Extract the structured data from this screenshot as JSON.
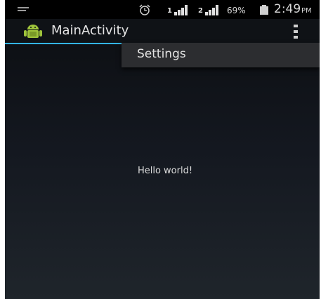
{
  "status_bar": {
    "battery_percent": "69%",
    "time": "2:49",
    "ampm": "PM",
    "sim1_label": "1",
    "sim2_label": "2",
    "icons": [
      "notification-icon",
      "alarm-icon",
      "signal-sim1-icon",
      "signal-sim2-icon",
      "battery-icon"
    ]
  },
  "action_bar": {
    "title": "MainActivity",
    "app_icon": "android-icon",
    "overflow_icon": "overflow-menu-icon",
    "accent_color": "#33b5e5"
  },
  "overflow_menu": {
    "items": [
      {
        "label": "Settings"
      }
    ]
  },
  "content": {
    "message": "Hello world!"
  }
}
